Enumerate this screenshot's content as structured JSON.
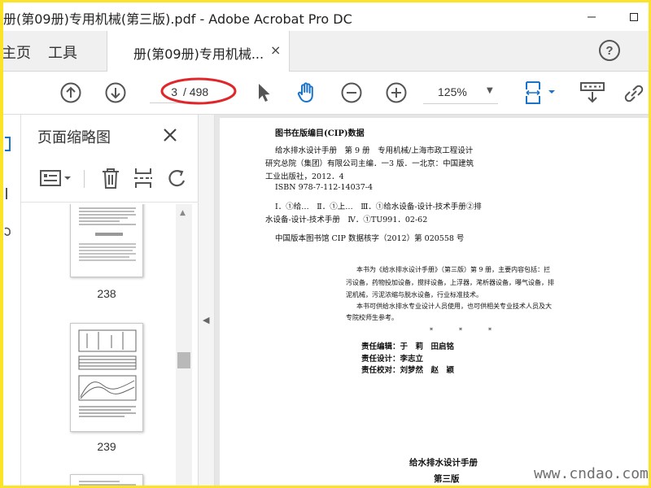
{
  "window": {
    "title": "册(第09册)专用机械(第三版).pdf - Adobe Acrobat Pro DC"
  },
  "nav": {
    "home_label": "主页",
    "tools_label": "工具"
  },
  "doc_tab": {
    "label": "册(第09册)专用机械...",
    "close": "×"
  },
  "toolbar": {
    "current_page": "3",
    "page_total": "/ 498",
    "zoom": "125%"
  },
  "panel": {
    "title": "页面缩略图",
    "close": "×",
    "thumbnails": [
      {
        "label": "238"
      },
      {
        "label": "239"
      }
    ]
  },
  "document": {
    "lines": [
      {
        "text": "图书在版编目(CIP)数据",
        "bold": true
      },
      {
        "text": "给水排水设计手册　第 9 册　专用机械/上海市政工程设计"
      },
      {
        "text": "研究总院（集团）有限公司主编．一3 版．一北京：中国建筑"
      },
      {
        "text": "工业出版社，2012．4"
      },
      {
        "text": "ISBN 978-7-112-14037-4"
      },
      {
        "text": "Ⅰ．①给…　Ⅱ．①上…　Ⅲ．①给水设备-设计-技术手册②排"
      },
      {
        "text": "水设备-设计-技术手册　Ⅳ．①TU991．02-62"
      },
      {
        "text": "中国版本图书馆 CIP 数据核字（2012）第 020558 号"
      },
      {
        "text": "本书为《给水排水设计手册》（第三版）第 9 册，主要内容包括：拦"
      },
      {
        "text": "污设备，药物投加设备，搅拌设备，上浮器，滗析器设备，曝气设备，排"
      },
      {
        "text": "泥机械，污泥浓缩与脱水设备，行业标准技术。"
      },
      {
        "text": "本书可供给水排水专业设计人员使用，也可供相关专业技术人员及大"
      },
      {
        "text": "专院校师生参考。"
      },
      {
        "text": "*　　　　*　　　　*"
      },
      {
        "text": "责任编辑：于　莉　田启铭",
        "bold": true
      },
      {
        "text": "责任设计：李志立",
        "bold": true
      },
      {
        "text": "责任校对：刘梦然　赵　颖",
        "bold": true
      },
      {
        "text": "给水排水设计手册",
        "bold": true
      },
      {
        "text": "第三版",
        "bold": true
      }
    ]
  },
  "watermark": "www.cndao.com",
  "colors": {
    "accent": "#1a73c9",
    "frame": "#fbe428",
    "annotation": "#e0262b"
  },
  "icons": [
    "up-arrow-circle-icon",
    "down-arrow-circle-icon",
    "cursor-arrow-icon",
    "hand-icon",
    "zoom-out-icon",
    "zoom-in-icon",
    "fit-page-icon",
    "read-mode-icon",
    "link-icon",
    "help-icon",
    "thumbnail-options-icon",
    "trash-icon",
    "insert-page-icon",
    "rotate-icon"
  ]
}
